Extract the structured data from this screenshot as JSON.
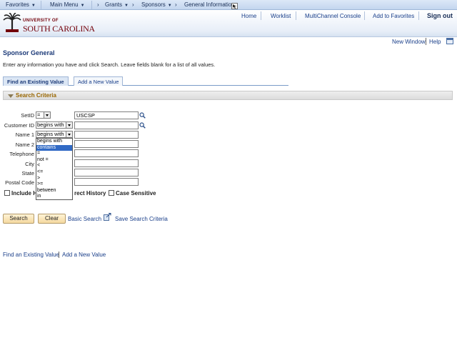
{
  "menubar": {
    "items": [
      {
        "label": "Favorites"
      },
      {
        "label": "Main Menu"
      },
      {
        "label": "Grants"
      },
      {
        "label": "Sponsors"
      },
      {
        "label": "General Information"
      }
    ]
  },
  "header": {
    "logo_line1": "UNIVERSITY OF",
    "logo_line2": "SOUTH CAROLINA",
    "nav": {
      "home": "Home",
      "worklist": "Worklist",
      "multichannel": "MultiChannel Console",
      "add_favorites": "Add to Favorites",
      "signout": "Sign out"
    }
  },
  "utility": {
    "new_window": "New Window",
    "help": "Help"
  },
  "page": {
    "title": "Sponsor General",
    "instructions": "Enter any information you have and click Search. Leave fields blank for a list of all values."
  },
  "tabs": {
    "find": "Find an Existing Value",
    "add": "Add a New Value"
  },
  "section": {
    "title": "Search Criteria"
  },
  "form": {
    "setid": {
      "label": "SetID",
      "operator": "=",
      "value": "USCSP"
    },
    "customer_id": {
      "label": "Customer ID",
      "operator": "begins with",
      "value": ""
    },
    "name1": {
      "label": "Name 1",
      "operator": "begins with",
      "value": ""
    },
    "name2": {
      "label": "Name 2",
      "value": ""
    },
    "telephone": {
      "label": "Telephone",
      "value": ""
    },
    "city": {
      "label": "City",
      "value": ""
    },
    "state": {
      "label": "State",
      "value": ""
    },
    "postal_code": {
      "label": "Postal Code",
      "value": ""
    }
  },
  "dropdown_options": [
    {
      "label": "begins with",
      "highlighted": false
    },
    {
      "label": "contains",
      "highlighted": true
    },
    {
      "label": "=",
      "highlighted": false
    },
    {
      "label": "not =",
      "highlighted": false
    },
    {
      "label": "<",
      "highlighted": false
    },
    {
      "label": "<=",
      "highlighted": false
    },
    {
      "label": ">",
      "highlighted": false
    },
    {
      "label": ">=",
      "highlighted": false
    },
    {
      "label": "between",
      "highlighted": false
    },
    {
      "label": "in",
      "highlighted": false
    }
  ],
  "checkboxes": {
    "include_history_left": "Include H",
    "include_history_right": "rect History",
    "case_sensitive": "Case Sensitive"
  },
  "buttons": {
    "search": "Search",
    "clear": "Clear",
    "basic_search": "Basic Search",
    "save_criteria": "Save Search Criteria"
  },
  "footer": {
    "find": "Find an Existing Value",
    "add": "Add a New Value"
  },
  "colors": {
    "brand": "#73000a",
    "link": "#1a3f8a",
    "highlight": "#316ac5",
    "section_title": "#996600"
  }
}
